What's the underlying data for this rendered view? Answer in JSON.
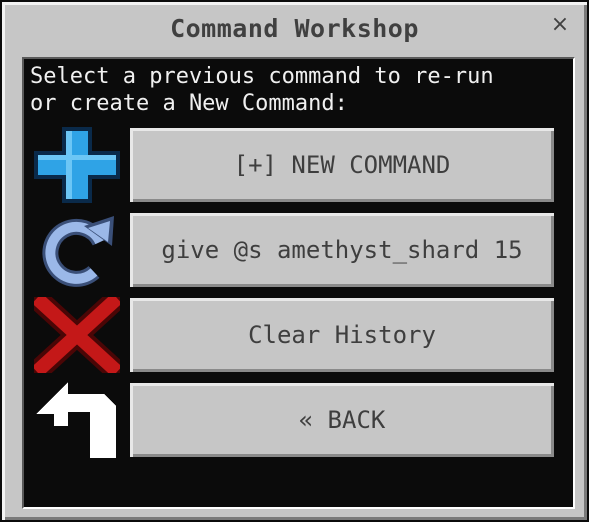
{
  "window": {
    "title": "Command Workshop",
    "close_label": "×"
  },
  "prompt": "Select a previous command to re-run\nor create a New Command:",
  "buttons": [
    {
      "label": "[+] NEW COMMAND",
      "icon": "plus-icon"
    },
    {
      "label": "give @s amethyst_shard 15",
      "icon": "refresh-icon"
    },
    {
      "label": "Clear History",
      "icon": "x-icon"
    },
    {
      "label": "« BACK",
      "icon": "back-arrow-icon"
    }
  ],
  "colors": {
    "frame": "#c6c6c6",
    "panel": "#0b0b0b",
    "plus": "#2fa3e6",
    "refresh": "#9bb8e8",
    "clear": "#c41818",
    "back": "#ffffff"
  }
}
